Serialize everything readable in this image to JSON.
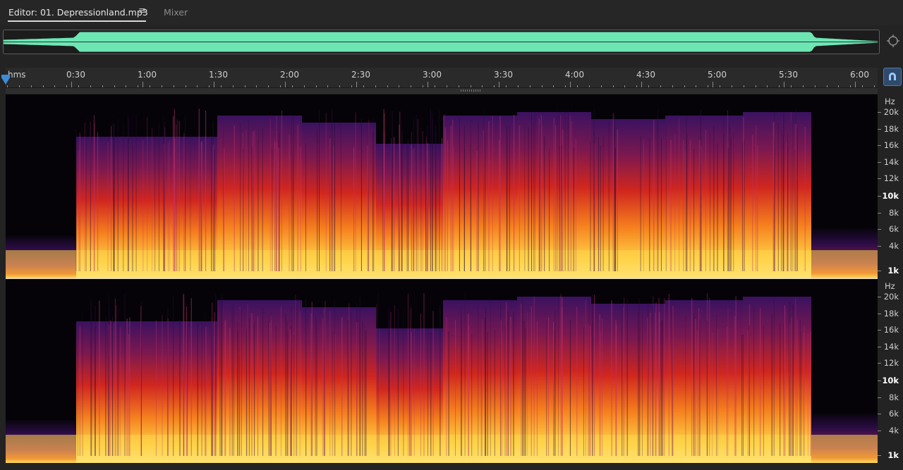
{
  "tabs": {
    "editor_label": "Editor: 01. Depressionland.mp3",
    "menu_glyph": "≡",
    "mixer_label": "Mixer"
  },
  "ruler": {
    "unit_label": "hms",
    "labels": [
      "0:30",
      "1:00",
      "1:30",
      "2:00",
      "2:30",
      "3:00",
      "3:30",
      "4:00",
      "4:30",
      "5:00",
      "5:30",
      "6:00"
    ]
  },
  "frequency_axis": {
    "unit": "Hz",
    "labels": [
      "20k",
      "18k",
      "16k",
      "14k",
      "12k",
      "10k",
      "8k",
      "6k",
      "4k",
      "1k"
    ]
  },
  "icons": {
    "zoom": "zoom-navigator-icon",
    "snap": "magnet-snap-icon",
    "playhead": "playhead-marker-icon"
  },
  "colors": {
    "waveform": "#6ee6b4",
    "playhead": "#3d8bd6",
    "spectrum_high": "#ffe066",
    "spectrum_mid": "#e8321e",
    "spectrum_low": "#4a1a6a"
  }
}
